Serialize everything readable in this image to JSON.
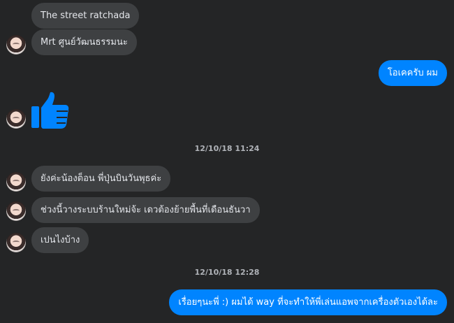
{
  "messages": [
    {
      "text": "The street ratchada",
      "side": "incoming"
    },
    {
      "text": "Mrt ศูนย์วัฒนธรรมนะ",
      "side": "incoming"
    },
    {
      "text": "โอเคครับ ผม",
      "side": "outgoing"
    },
    {
      "text": "ยังค่ะน้องต็อน พี่ปุ่นบินวันพุธค่ะ",
      "side": "incoming"
    },
    {
      "text": "ช่วงนี้วางระบบร้านใหม่จ้ะ เดวต้องย้ายพื้นที่เดือนธันวา",
      "side": "incoming"
    },
    {
      "text": "เปนไงบ้าง",
      "side": "incoming"
    },
    {
      "text": "เรื่อยๆนะพี่ :) ผมได้ way ที่จะทำให้พี่เล่นแอพจากเครื่องตัวเองได้ละ",
      "side": "outgoing"
    }
  ],
  "timestamps": [
    "12/10/18 11:24",
    "12/10/18 12:28"
  ],
  "colors": {
    "background": "#242526",
    "incoming_bubble": "#3e4042",
    "outgoing_bubble": "#0084ff",
    "like_icon": "#0084ff",
    "timestamp_text": "#b0b3b8"
  },
  "icons": {
    "like": "thumbs-up-icon",
    "avatar": "contact-avatar"
  }
}
